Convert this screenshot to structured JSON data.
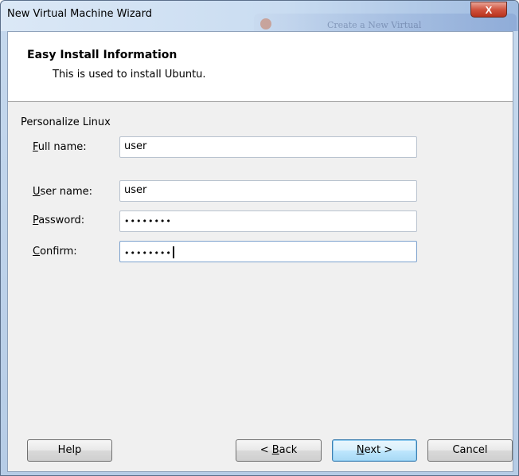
{
  "window": {
    "title": "New Virtual Machine Wizard",
    "close_glyph": "X"
  },
  "background_window": {
    "title": "Create a New Virtual"
  },
  "header": {
    "title": "Easy Install Information",
    "subtitle": "This is used to install Ubuntu."
  },
  "form": {
    "group_label": "Personalize Linux",
    "full_name": {
      "mnemonic": "F",
      "label_rest": "ull name:",
      "value": "user"
    },
    "user_name": {
      "mnemonic": "U",
      "label_rest": "ser name:",
      "value": "user"
    },
    "password": {
      "mnemonic": "P",
      "label_rest": "assword:",
      "masked": "••••••••"
    },
    "confirm": {
      "mnemonic": "C",
      "label_rest": "onfirm:",
      "masked": "••••••••"
    }
  },
  "buttons": {
    "help": "Help",
    "back_prefix": "< ",
    "back_mnemonic": "B",
    "back_rest": "ack",
    "next_mnemonic": "N",
    "next_rest": "ext >",
    "cancel": "Cancel"
  },
  "icons": {
    "close": "close-icon"
  }
}
